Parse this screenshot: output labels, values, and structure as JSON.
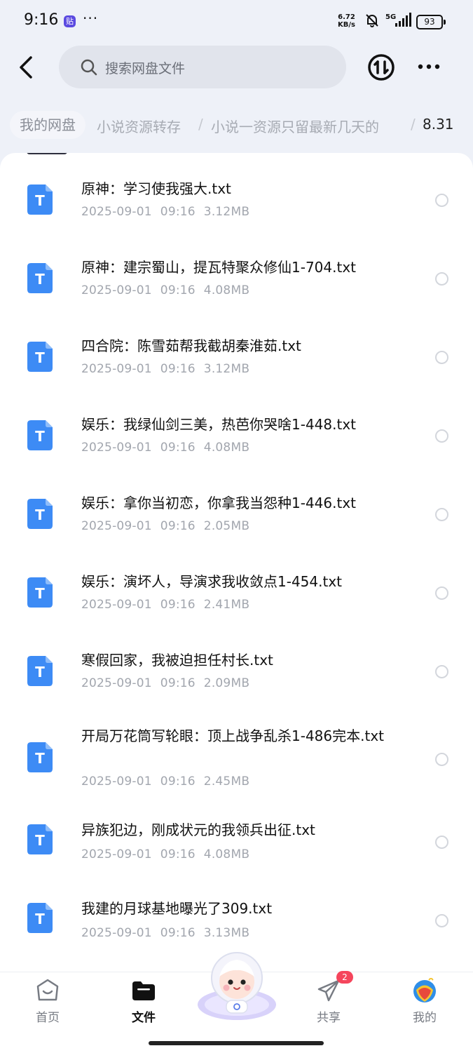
{
  "status_bar": {
    "time": "9:16",
    "app_badge": "贴",
    "dots": "···",
    "net_speed": "6.72",
    "net_unit": "KB/s",
    "network": "5G",
    "battery": "93"
  },
  "header": {
    "search_placeholder": "搜索网盘文件"
  },
  "breadcrumb": {
    "home": "我的网盘",
    "items": [
      "小说资源转存",
      "小说一资源只留最新几天的",
      "8.31"
    ],
    "separator": "/"
  },
  "files": [
    {
      "name": "原神：学习使我强大.txt",
      "date": "2025-09-01",
      "time": "09:16",
      "size": "3.12MB"
    },
    {
      "name": "原神：建宗蜀山，提瓦特聚众修仙1-704.txt",
      "date": "2025-09-01",
      "time": "09:16",
      "size": "4.08MB"
    },
    {
      "name": "四合院：陈雪茹帮我截胡秦淮茹.txt",
      "date": "2025-09-01",
      "time": "09:16",
      "size": "3.12MB"
    },
    {
      "name": "娱乐：我绿仙剑三美，热芭你哭啥1-448.txt",
      "date": "2025-09-01",
      "time": "09:16",
      "size": "4.08MB"
    },
    {
      "name": "娱乐：拿你当初恋，你拿我当怨种1-446.txt",
      "date": "2025-09-01",
      "time": "09:16",
      "size": "2.05MB"
    },
    {
      "name": "娱乐：演坏人，导演求我收敛点1-454.txt",
      "date": "2025-09-01",
      "time": "09:16",
      "size": "2.41MB"
    },
    {
      "name": "寒假回家，我被迫担任村长.txt",
      "date": "2025-09-01",
      "time": "09:16",
      "size": "2.09MB"
    },
    {
      "name": "开局万花筒写轮眼：顶上战争乱杀1-486完本.txt",
      "date": "2025-09-01",
      "time": "09:16",
      "size": "2.45MB"
    },
    {
      "name": "异族犯边，刚成状元的我领兵出征.txt",
      "date": "2025-09-01",
      "time": "09:16",
      "size": "4.08MB"
    },
    {
      "name": "我建的月球基地曝光了309.txt",
      "date": "2025-09-01",
      "time": "09:16",
      "size": "3.13MB"
    }
  ],
  "file_icon_letter": "T",
  "nav": {
    "home": "首页",
    "files": "文件",
    "share": "共享",
    "mine": "我的",
    "share_badge": "2"
  },
  "colors": {
    "file_icon": "#3d8bf5",
    "badge": "#f5455c",
    "background": "#eef1f8"
  }
}
